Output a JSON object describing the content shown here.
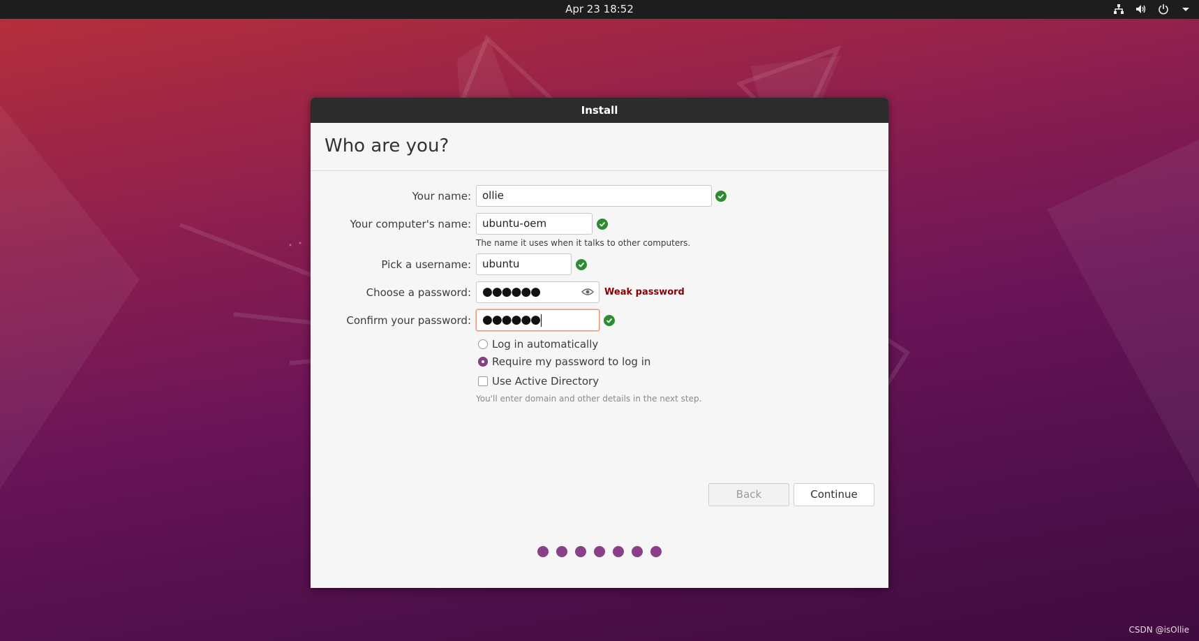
{
  "topbar": {
    "clock": "Apr 23  18:52",
    "icons": [
      "network-icon",
      "volume-icon",
      "power-icon",
      "chevron-down-icon"
    ]
  },
  "window": {
    "title": "Install",
    "heading": "Who are you?",
    "form": {
      "name": {
        "label": "Your name:",
        "value": "ollie",
        "status": "valid"
      },
      "computer": {
        "label": "Your computer's name:",
        "value": "ubuntu-oem",
        "hint": "The name it uses when it talks to other computers.",
        "status": "valid"
      },
      "username": {
        "label": "Pick a username:",
        "value": "ubuntu",
        "status": "valid"
      },
      "password": {
        "label": "Choose a password:",
        "value": "●●●●●●",
        "strength": "Weak password"
      },
      "confirm": {
        "label": "Confirm your password:",
        "value": "●●●●●●",
        "status": "valid"
      }
    },
    "options": {
      "login_auto": {
        "label": "Log in automatically",
        "selected": false
      },
      "require_password": {
        "label": "Require my password to log in",
        "selected": true
      },
      "active_directory": {
        "label": "Use Active Directory",
        "checked": false,
        "hint": "You'll enter domain and other details in the next step."
      }
    },
    "buttons": {
      "back": "Back",
      "continue": "Continue"
    },
    "progress": {
      "total_steps": 7
    }
  },
  "watermark": "CSDN @isOllie",
  "colors": {
    "accent": "#8a3f89",
    "valid": "#2e8b33",
    "weak": "#8b0000",
    "titlebar": "#2c2c2c"
  }
}
